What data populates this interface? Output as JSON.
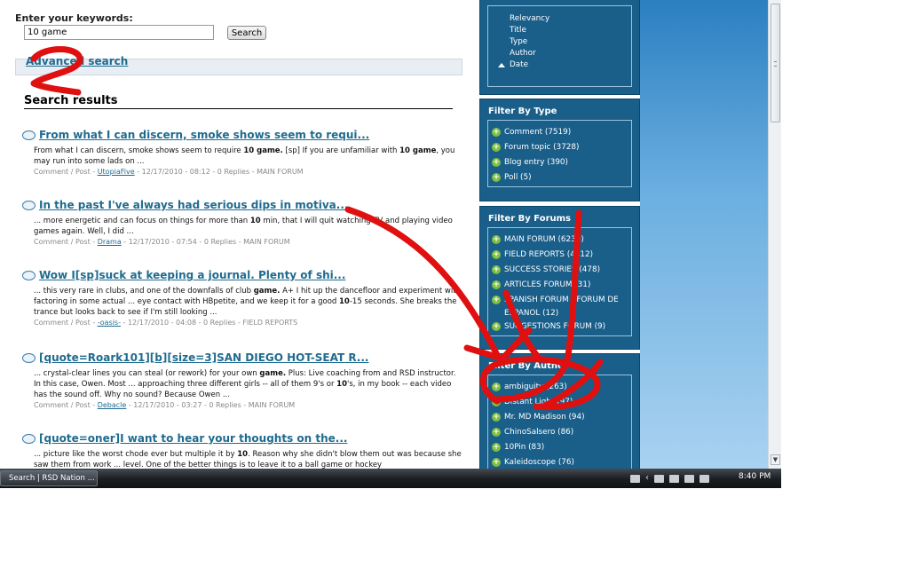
{
  "search": {
    "label": "Enter your keywords:",
    "value": "10 game",
    "button": "Search",
    "advanced_link": "Advanced search",
    "results_title": "Search results"
  },
  "results": [
    {
      "title": "From what I can discern, smoke shows seem to requi...",
      "snippet_html": "From what I can discern, smoke shows seem to require <b>10 game.</b> [sp] If you are unfamiliar with <b>10 game</b>, you may run into some lads on ...",
      "meta_prefix": "Comment / Post - ",
      "author": "UtopiaFive",
      "meta_suffix": " - 12/17/2010 - 08:12 - 0 Replies - MAIN FORUM"
    },
    {
      "title": "In the past I've always had serious dips in motiva...",
      "snippet_html": "... more energetic and can focus on things for more than <b>10</b> min, that I will quit watching TV and playing video games again. Well, I did ...",
      "meta_prefix": "Comment / Post - ",
      "author": "Drama",
      "meta_suffix": " - 12/17/2010 - 07:54 - 0 Replies - MAIN FORUM"
    },
    {
      "title": "Wow I[sp]suck at keeping a journal. Plenty of shi...",
      "snippet_html": "... this very rare in clubs, and one of the downfalls of club <b>game.</b> A+ I hit up the dancefloor and experiment with factoring in some actual ... eye contact with HBpetite, and we keep it for a good <b>10</b>-15 seconds. She breaks the trance but looks back to see if I'm still looking ...",
      "meta_prefix": "Comment / Post - ",
      "author": "-oasis-",
      "meta_suffix": " - 12/17/2010 - 04:08 - 0 Replies - FIELD REPORTS"
    },
    {
      "title": "[quote=Roark101][b][size=3]SAN DIEGO HOT-SEAT R...",
      "snippet_html": "... crystal-clear lines you can steal (or rework) for your own <b>game.</b> Plus: Live coaching from and RSD instructor. In this case, Owen. Most ... approaching three different girls -- all of them 9's or <b>10</b>'s, in my book -- each video has the sound off. Why no sound? Because Owen ...",
      "meta_prefix": "Comment / Post - ",
      "author": "Debacle",
      "meta_suffix": " - 12/17/2010 - 03:27 - 0 Replies - MAIN FORUM"
    },
    {
      "title": "[quote=oner]I want to hear your thoughts on the...",
      "snippet_html": "... picture like the worst chode ever but multiple it by <b>10</b>. Reason why she didn't blow them out was because she saw them from work ... level. One of the better things is to leave it to a ball game or hockey",
      "meta_prefix": "",
      "author": "",
      "meta_suffix": ""
    }
  ],
  "sort": {
    "items": [
      "Relevancy",
      "Title",
      "Type",
      "Author",
      "Date"
    ],
    "active_index": 4
  },
  "filter_type": {
    "title": "Filter By Type",
    "items": [
      "Comment (7519)",
      "Forum topic (3728)",
      "Blog entry (390)",
      "Poll (5)"
    ]
  },
  "filter_forums": {
    "title": "Filter By Forums",
    "items": [
      "MAIN FORUM (6230)",
      "FIELD REPORTS (4412)",
      "SUCCESS STORIES (478)",
      "ARTICLES FORUM (31)",
      "SPANISH FORUM - FORUM DE",
      "ESPANOL (12)",
      "SUGGESTIONS FORUM (9)"
    ]
  },
  "filter_author": {
    "title": "Filter By Author",
    "items": [
      "ambiguity (263)",
      "Distant Light (97)",
      "Mr. MD Madison (94)",
      "ChinoSalsero (86)",
      "10Pin (83)",
      "Kaleidoscope (76)"
    ]
  },
  "taskbar": {
    "task_label": "Search | RSD Nation ...",
    "clock": "8:40 PM"
  },
  "colors": {
    "link": "#1f6b8f",
    "sidebar_panel": "#1a5f8a",
    "facet_plus": "#7fbf3f",
    "annotation_red": "#e01010"
  }
}
